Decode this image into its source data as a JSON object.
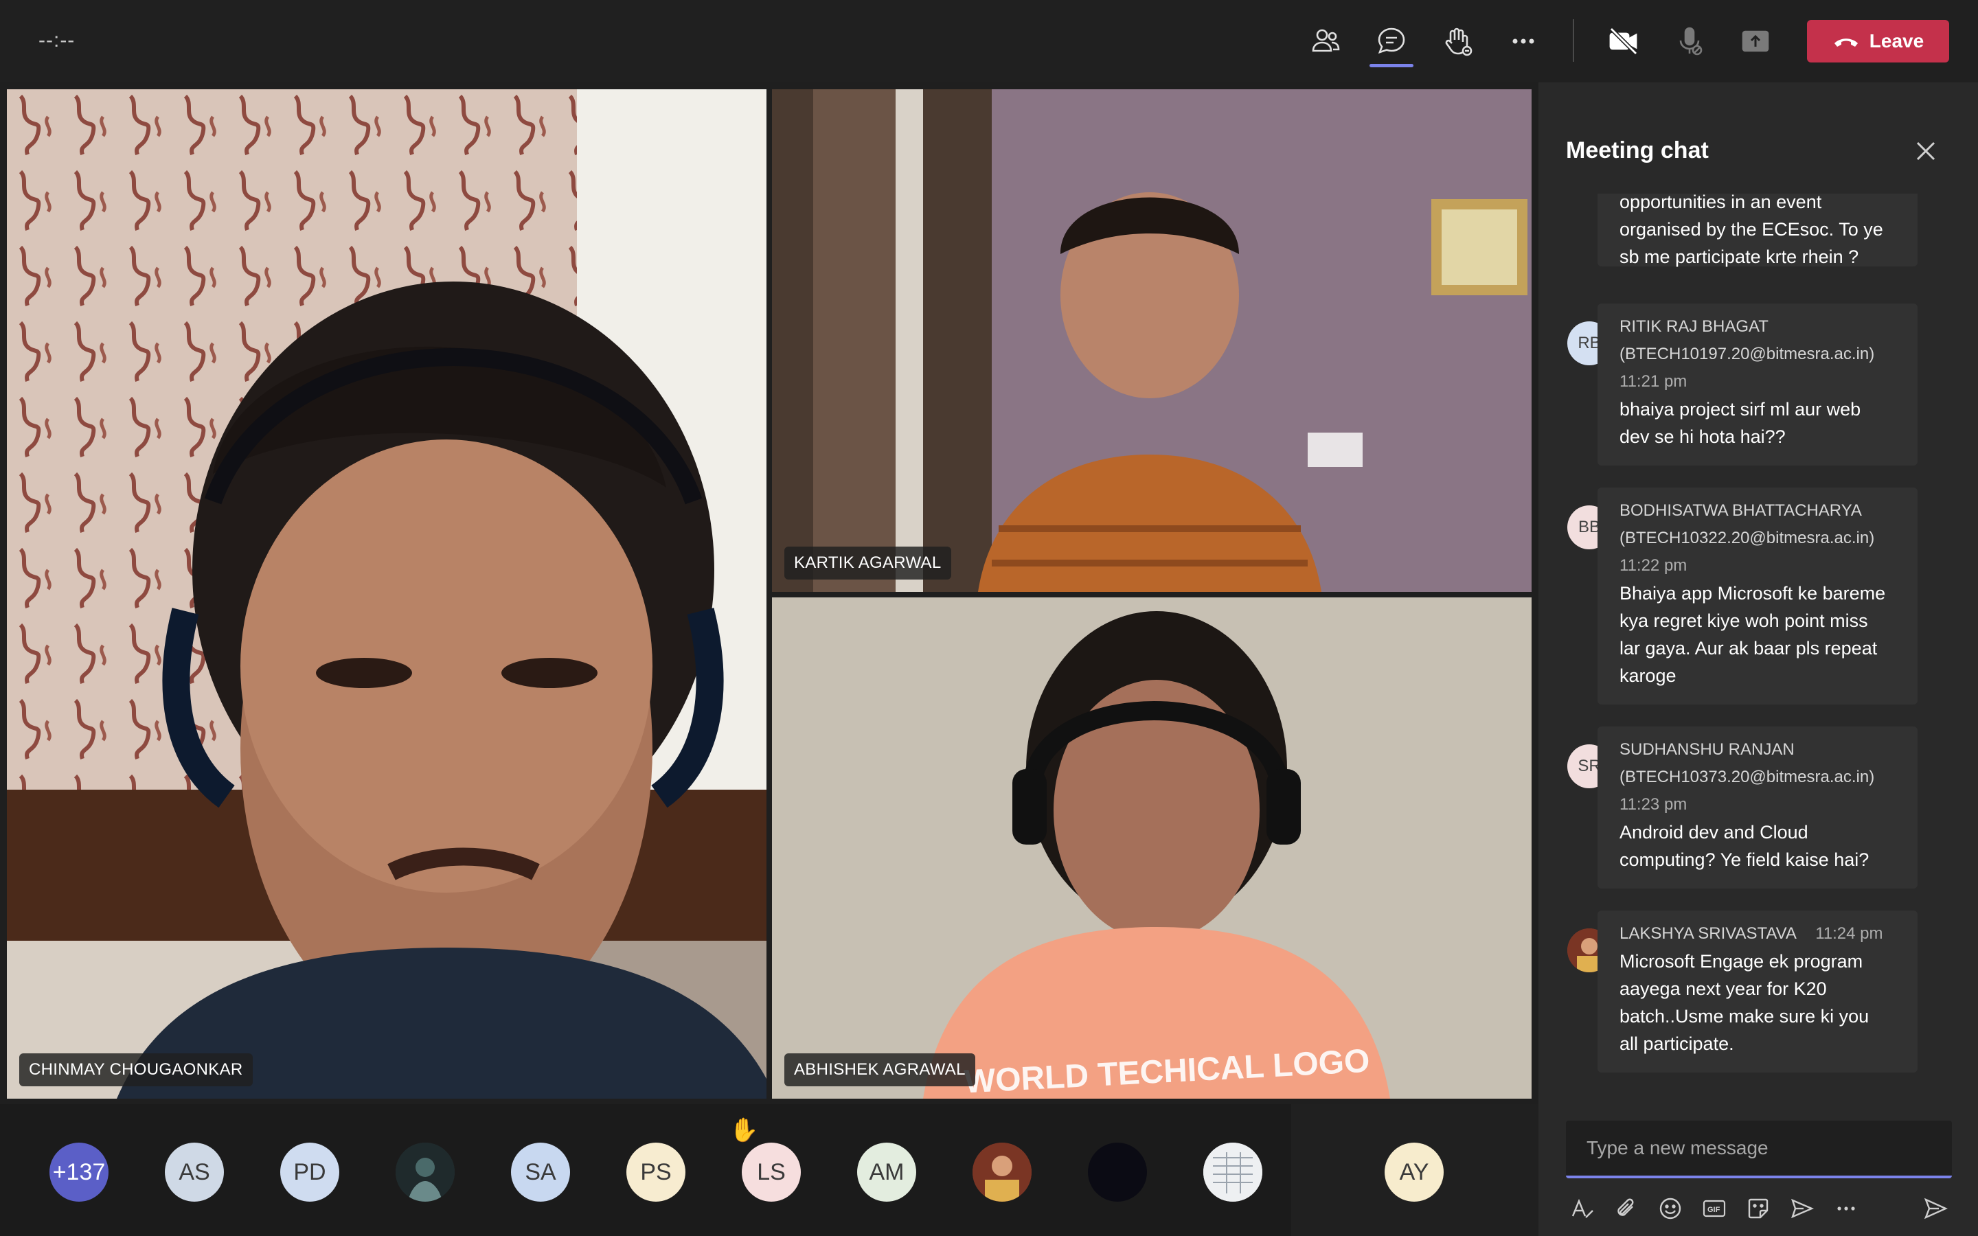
{
  "topbar": {
    "timer": "--:--",
    "icons": [
      "people-icon",
      "chat-icon",
      "raise-hand-icon",
      "more-options-icon",
      "camera-off-icon",
      "mic-off-icon",
      "share-tray-icon"
    ],
    "leave_label": "Leave",
    "leave_color": "#c4314b",
    "accent": "#7b83eb"
  },
  "videos": [
    {
      "name": "CHINMAY CHOUGAONKAR"
    },
    {
      "name": "KARTIK AGARWAL"
    },
    {
      "name": "ABHISHEK AGRAWAL"
    }
  ],
  "chat": {
    "title": "Meeting chat",
    "messages": [
      {
        "initials": "",
        "sender": "",
        "email": "",
        "time": "",
        "text_lines": [
          "opportunities in an event",
          "organised by the ECEsoc. To ye",
          "sb me participate krte rhein ?"
        ]
      },
      {
        "initials": "RB",
        "sender": "RITIK RAJ BHAGAT",
        "email": "(BTECH10197.20@bitmesra.ac.in)",
        "time": "11:21 pm",
        "text_lines": [
          "bhaiya project sirf ml aur web",
          "dev se hi hota hai??"
        ]
      },
      {
        "initials": "BB",
        "sender": "BODHISATWA BHATTACHARYA",
        "email": "(BTECH10322.20@bitmesra.ac.in)",
        "time": "11:22 pm",
        "text_lines": [
          "Bhaiya app Microsoft ke bareme",
          "kya regret kiye woh point miss",
          "lar gaya. Aur ak baar pls repeat",
          "karoge"
        ]
      },
      {
        "initials": "SR",
        "sender": "SUDHANSHU RANJAN",
        "email": "(BTECH10373.20@bitmesra.ac.in)",
        "time": "11:23 pm",
        "text_lines": [
          "Android dev and Cloud",
          "computing? Ye field kaise hai?"
        ]
      },
      {
        "initials": "",
        "sender": "LAKSHYA SRIVASTAVA",
        "email": "",
        "time": "11:24 pm",
        "text_lines": [
          "Microsoft Engage ek program",
          "aayega next year for K20",
          "batch..Usme make sure ki you",
          "all participate."
        ]
      }
    ],
    "compose_placeholder": "Type a new message",
    "compose_tools": [
      "format-icon",
      "attach-icon",
      "emoji-icon",
      "gif-icon",
      "sticker-icon",
      "schedule-send-icon",
      "more-icon",
      "send-icon"
    ]
  },
  "participants": [
    {
      "label": "+137",
      "color": "#5b5fc7",
      "text_color": "#ffffff"
    },
    {
      "label": "AS",
      "color": "#cfd9e6",
      "text_color": "#3a3a3a"
    },
    {
      "label": "PD",
      "color": "#cfdcf0",
      "text_color": "#3a3a3a"
    },
    {
      "label": "",
      "color": "#2c3a3c",
      "text_color": "#ffffff"
    },
    {
      "label": "SA",
      "color": "#c8d8f0",
      "text_color": "#3a3a3a"
    },
    {
      "label": "PS",
      "color": "#f7ecd0",
      "text_color": "#3a3a3a"
    },
    {
      "label": "LS",
      "color": "#f6dede",
      "text_color": "#3a3a3a"
    },
    {
      "label": "AM",
      "color": "#e3eddf",
      "text_color": "#3a3a3a"
    },
    {
      "label": "",
      "color": "#8a3a2a",
      "text_color": "#ffffff"
    },
    {
      "label": "",
      "color": "#0b0b14",
      "text_color": "#ffffff"
    },
    {
      "label": "",
      "color": "#e9ecef",
      "text_color": "#3a3a3a"
    },
    {
      "label": "AY",
      "color": "#f7eccd",
      "text_color": "#3a3a3a"
    }
  ]
}
